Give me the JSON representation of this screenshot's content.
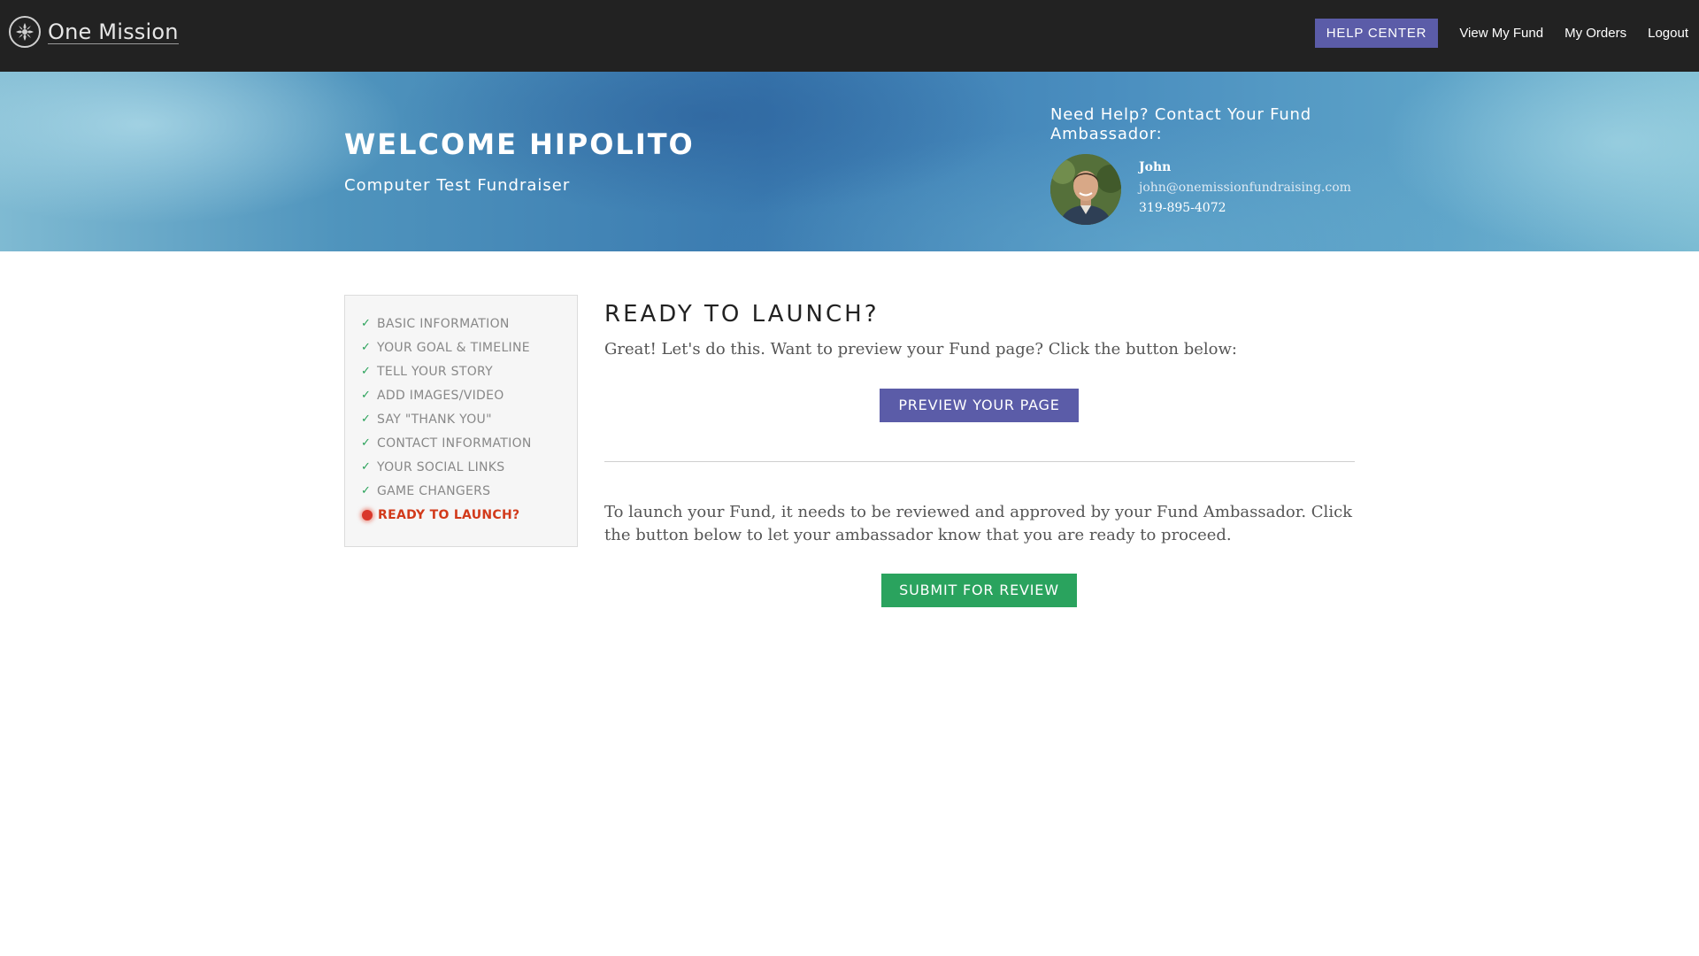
{
  "header": {
    "logo_text": "One Mission",
    "nav": {
      "help_center": "HELP CENTER",
      "view_my_fund": "View My Fund",
      "my_orders": "My Orders",
      "logout": "Logout"
    }
  },
  "hero": {
    "title": "WELCOME HIPOLITO",
    "subtitle": "Computer Test Fundraiser",
    "ambassador": {
      "heading": "Need Help? Contact Your Fund Ambassador:",
      "name": "John",
      "email": "john@onemissionfundraising.com",
      "phone": "319-895-4072"
    }
  },
  "sidebar": {
    "steps": [
      {
        "label": "BASIC INFORMATION",
        "status": "complete"
      },
      {
        "label": "YOUR GOAL & TIMELINE",
        "status": "complete"
      },
      {
        "label": "TELL YOUR STORY",
        "status": "complete"
      },
      {
        "label": "ADD IMAGES/VIDEO",
        "status": "complete"
      },
      {
        "label": "SAY \"THANK YOU\"",
        "status": "complete"
      },
      {
        "label": "CONTACT INFORMATION",
        "status": "complete"
      },
      {
        "label": "YOUR SOCIAL LINKS",
        "status": "complete"
      },
      {
        "label": "GAME CHANGERS",
        "status": "complete"
      },
      {
        "label": "READY TO LAUNCH?",
        "status": "current"
      }
    ],
    "check_glyph": "✓"
  },
  "main": {
    "title": "READY TO LAUNCH?",
    "preview_text": "Great! Let's do this. Want to preview your Fund page? Click the button below:",
    "preview_button": "PREVIEW YOUR PAGE",
    "launch_text": "To launch your Fund, it needs to be reviewed and approved by your Fund Ambassador. Click the button below to let your ambassador know that you are ready to proceed.",
    "submit_button": "SUBMIT FOR REVIEW"
  },
  "colors": {
    "topbar": "#222222",
    "accent_purple": "#5b5ca8",
    "accent_green": "#2aa35e",
    "active_step": "#d23a1a"
  }
}
